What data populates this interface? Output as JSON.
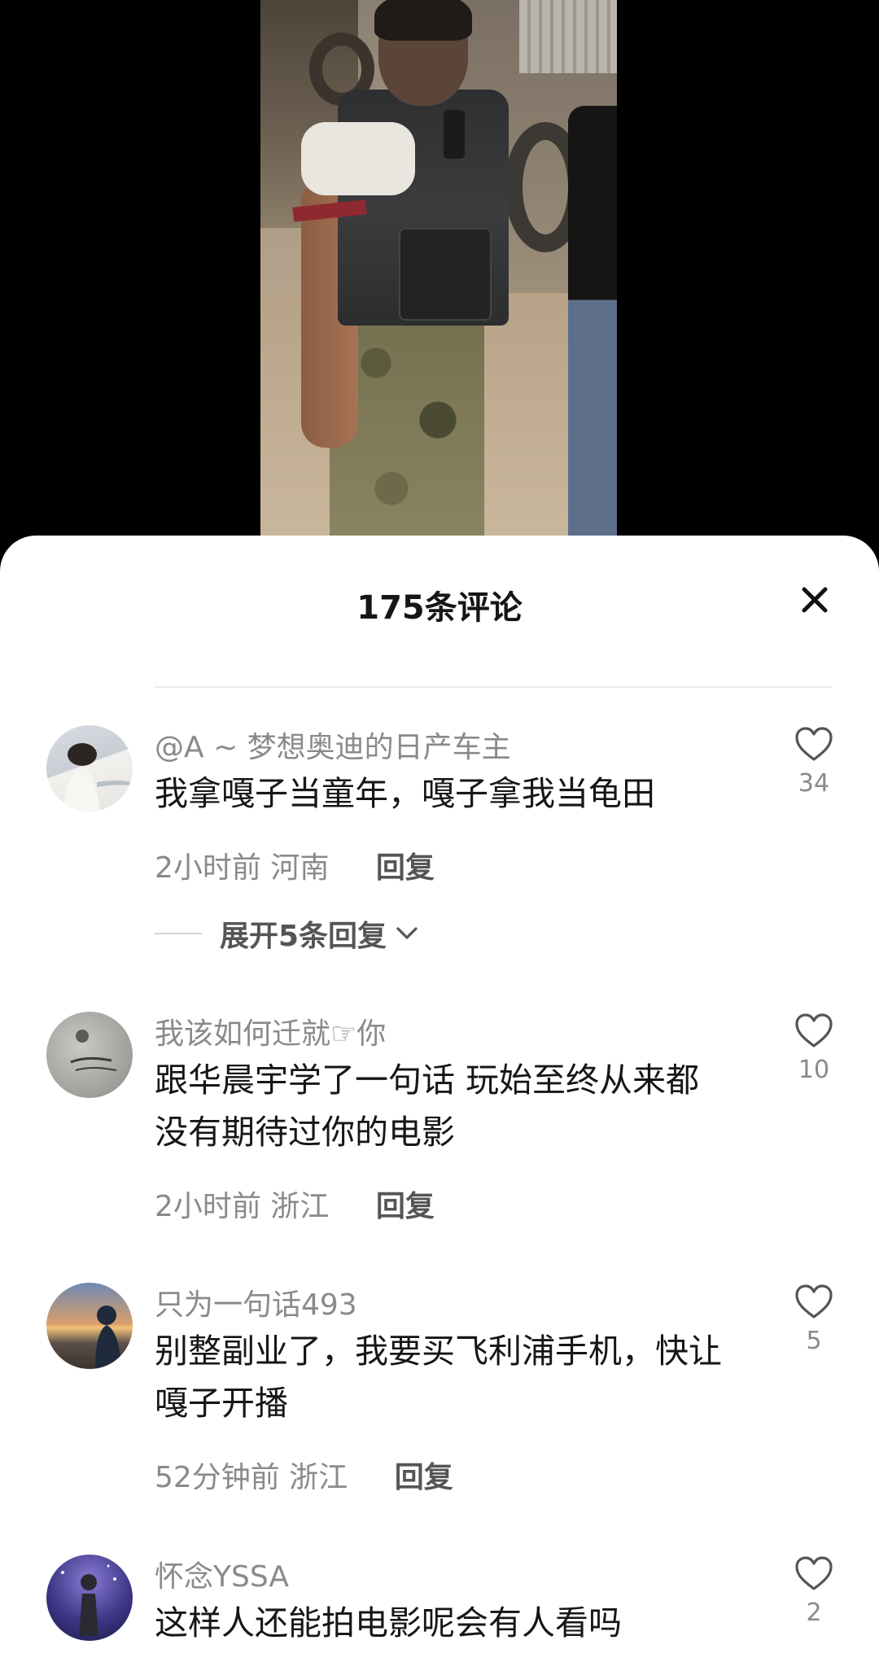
{
  "sheet": {
    "title": "175条评论"
  },
  "comments": [
    {
      "user": "@A ~ 梦想奥迪的日产车主",
      "text": "我拿嘎子当童年，嘎子拿我当龟田",
      "time": "2小时前",
      "location": "河南",
      "reply_label": "回复",
      "likes": "34",
      "expand_label": "展开5条回复"
    },
    {
      "user": "我该如何迁就☞你",
      "text": "跟华晨宇学了一句话  玩始至终从来都没有期待过你的电影",
      "time": "2小时前",
      "location": "浙江",
      "reply_label": "回复",
      "likes": "10"
    },
    {
      "user": "只为一句话493",
      "text": "别整副业了，我要买飞利浦手机，快让嘎子开播",
      "time": "52分钟前",
      "location": "浙江",
      "reply_label": "回复",
      "likes": "5"
    },
    {
      "user": "怀念YSSA",
      "text": "这样人还能拍电影呢会有人看吗",
      "likes": "2"
    }
  ],
  "colors": {
    "sheet_bg": "#ffffff",
    "text_primary": "#161616",
    "text_secondary": "#8a8a8a"
  }
}
